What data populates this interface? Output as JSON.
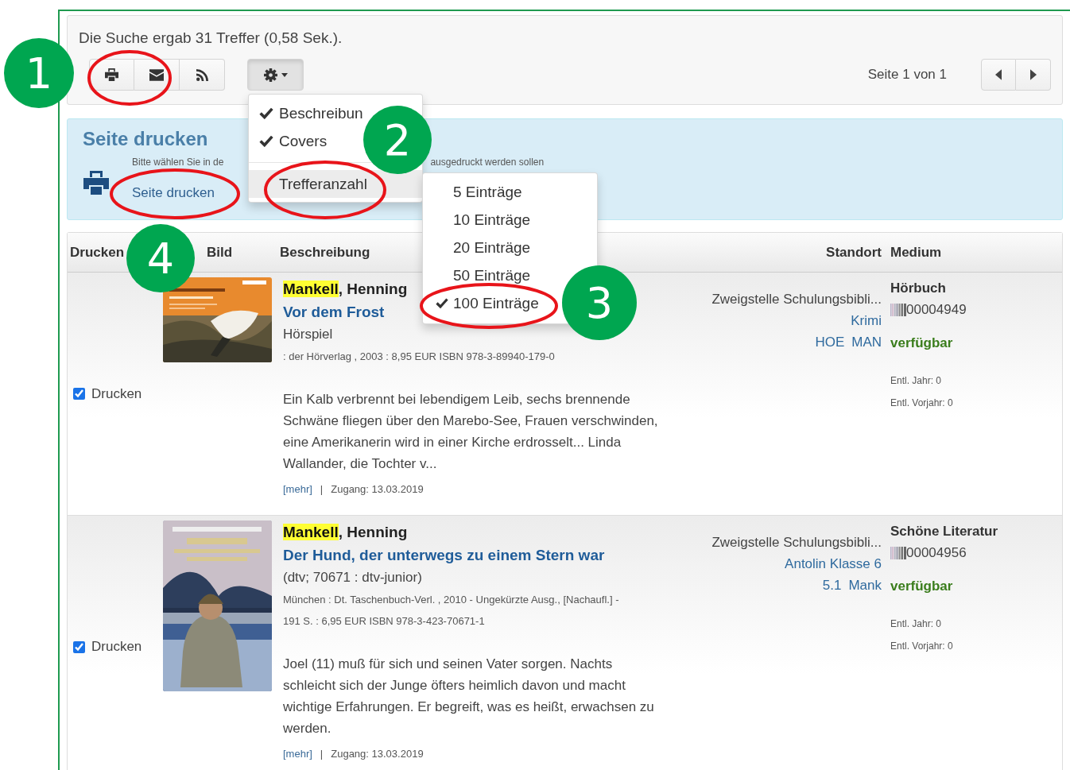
{
  "summary": "Die Suche ergab 31 Treffer (0,58 Sek.).",
  "toolbar": {
    "pagination": "Seite 1 von 1"
  },
  "options_menu": {
    "items": [
      {
        "kind": "toggle",
        "label": "Beschreibun",
        "checked": true,
        "selected": false
      },
      {
        "kind": "toggle",
        "label": "Covers",
        "checked": true,
        "selected": false
      },
      {
        "kind": "submenu",
        "label": "Trefferanzahl",
        "selected": true
      }
    ],
    "submenu": [
      {
        "label": "5 Einträge",
        "checked": false
      },
      {
        "label": "10 Einträge",
        "checked": false
      },
      {
        "label": "20 Einträge",
        "checked": false
      },
      {
        "label": "50 Einträge",
        "checked": false
      },
      {
        "label": "100 Einträge",
        "checked": true
      }
    ]
  },
  "print_panel": {
    "title": "Seite drucken",
    "hint_start": "Bitte wählen Sie in de",
    "hint_end": "ausgedruckt werden sollen",
    "link": "Seite drucken"
  },
  "table": {
    "columns": [
      "Drucken",
      "Bild",
      "Beschreibung",
      "Standort",
      "Medium"
    ],
    "rows": [
      {
        "checked": true,
        "print_label": "Drucken",
        "cover": {
          "kind": "picture"
        },
        "author_match": "Mankell",
        "author_rest": ", Henning",
        "title": "Vor dem Frost",
        "series": "Hörspiel",
        "imprint": ": der Hörverlag , 2003 : 8,95 EUR ISBN 978-3-89940-179-0",
        "abstract": "Ein Kalb verbrennt bei lebendigem Leib, sechs brennende Schwäne fliegen über den Marebo-See, Frauen verschwinden, eine Amerikanerin wird in einer Kirche erdrosselt... Linda Wallander, die Tochter v...",
        "more": "[mehr]",
        "separator": "|",
        "accession": "Zugang: 13.03.2019",
        "branch": "Zweigstelle Schulungsbibli...",
        "section": "Krimi",
        "shelfmark": [
          "HOE",
          "MAN"
        ],
        "medium": "Hörbuch",
        "barcode": "00004949",
        "availability": "verfügbar",
        "loans_year": "Entl. Jahr: 0",
        "loans_prev": "Entl. Vorjahr: 0"
      },
      {
        "checked": true,
        "print_label": "Drucken",
        "cover": {
          "kind": "picture"
        },
        "author_match": "Mankell",
        "author_rest": ", Henning",
        "title": "Der Hund, der unterwegs zu einem Stern war",
        "series": "(dtv; 70671 : dtv-junior)",
        "imprint": "München : Dt. Taschenbuch-Verl. , 2010 - Ungekürzte Ausg., [Nachaufl.] - 191 S. : 6,95 EUR ISBN 978-3-423-70671-1",
        "abstract": "Joel (11) muß für sich und seinen Vater sorgen. Nachts schleicht sich der Junge öfters heimlich davon und macht wichtige Erfahrungen. Er begreift, was es heißt, erwachsen zu werden.",
        "more": "[mehr]",
        "separator": "|",
        "accession": "Zugang: 13.03.2019",
        "branch": "Zweigstelle Schulungsbibli...",
        "section": "Antolin Klasse 6",
        "shelfmark": [
          "5.1",
          "Mank"
        ],
        "medium": "Schöne Literatur",
        "barcode": "00004956",
        "availability": "verfügbar",
        "loans_year": "Entl. Jahr: 0",
        "loans_prev": "Entl. Vorjahr: 0"
      }
    ]
  },
  "annotations": [
    {
      "label": "1"
    },
    {
      "label": "2"
    },
    {
      "label": "3"
    },
    {
      "label": "4"
    }
  ]
}
